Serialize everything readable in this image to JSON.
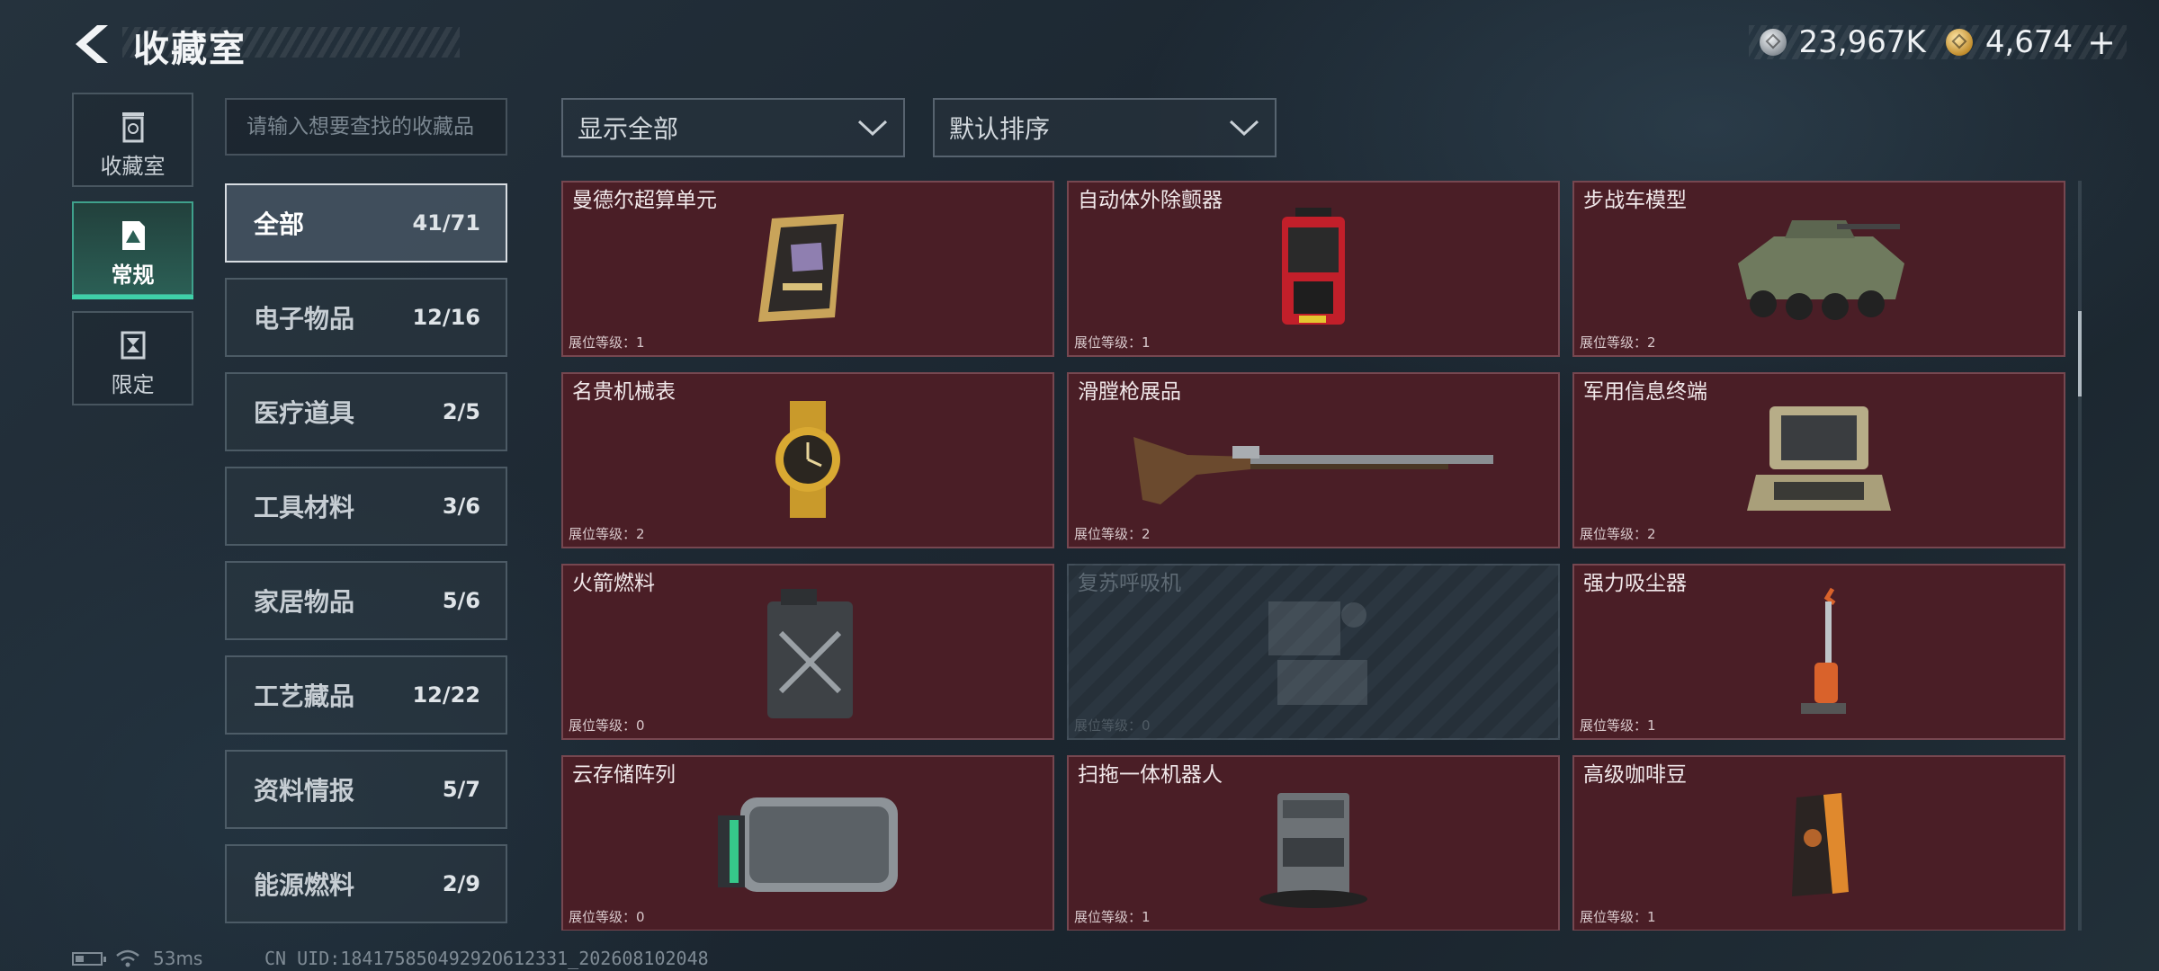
{
  "header": {
    "title": "收藏室"
  },
  "currency": {
    "silver": "23,967K",
    "gold": "4,674",
    "add_label": "+"
  },
  "side_tabs": [
    {
      "label": "收藏室",
      "icon": "trash-can-icon"
    },
    {
      "label": "常规",
      "icon": "triangle-card-icon",
      "active": true
    },
    {
      "label": "限定",
      "icon": "hourglass-card-icon"
    }
  ],
  "search": {
    "placeholder": "请输入想要查找的收藏品"
  },
  "filters": {
    "display": "显示全部",
    "sort": "默认排序"
  },
  "categories": [
    {
      "name": "全部",
      "count": "41/71",
      "active": true
    },
    {
      "name": "电子物品",
      "count": "12/16"
    },
    {
      "name": "医疗道具",
      "count": "2/5"
    },
    {
      "name": "工具材料",
      "count": "3/6"
    },
    {
      "name": "家居物品",
      "count": "5/6"
    },
    {
      "name": "工艺藏品",
      "count": "12/22"
    },
    {
      "name": "资料情报",
      "count": "5/7"
    },
    {
      "name": "能源燃料",
      "count": "2/9"
    }
  ],
  "items": [
    {
      "name": "曼德尔超算单元",
      "level": "展位等级：1",
      "icon": "supercomputer-unit-icon"
    },
    {
      "name": "自动体外除颤器",
      "level": "展位等级：1",
      "icon": "defibrillator-icon"
    },
    {
      "name": "步战车模型",
      "level": "展位等级：2",
      "icon": "armored-vehicle-icon"
    },
    {
      "name": "名贵机械表",
      "level": "展位等级：2",
      "icon": "gold-watch-icon"
    },
    {
      "name": "滑膛枪展品",
      "level": "展位等级：2",
      "icon": "musket-icon"
    },
    {
      "name": "军用信息终端",
      "level": "展位等级：2",
      "icon": "rugged-laptop-icon"
    },
    {
      "name": "火箭燃料",
      "level": "展位等级：0",
      "icon": "jerrycan-icon"
    },
    {
      "name": "复苏呼吸机",
      "level": "展位等级：0",
      "icon": "ventilator-icon",
      "locked": true
    },
    {
      "name": "强力吸尘器",
      "level": "展位等级：1",
      "icon": "vacuum-cleaner-icon"
    },
    {
      "name": "云存储阵列",
      "level": "展位等级：0",
      "icon": "storage-array-icon"
    },
    {
      "name": "扫拖一体机器人",
      "level": "展位等级：1",
      "icon": "mop-robot-icon"
    },
    {
      "name": "高级咖啡豆",
      "level": "展位等级：1",
      "icon": "coffee-bag-icon"
    }
  ],
  "footer": {
    "ping": "53ms",
    "uid": "CN UID:18417585049292O612331_202608102048"
  },
  "colors": {
    "card_bg": "#4a1e26",
    "active_tab": "#2b5f55",
    "accent": "#3fd0a8"
  }
}
